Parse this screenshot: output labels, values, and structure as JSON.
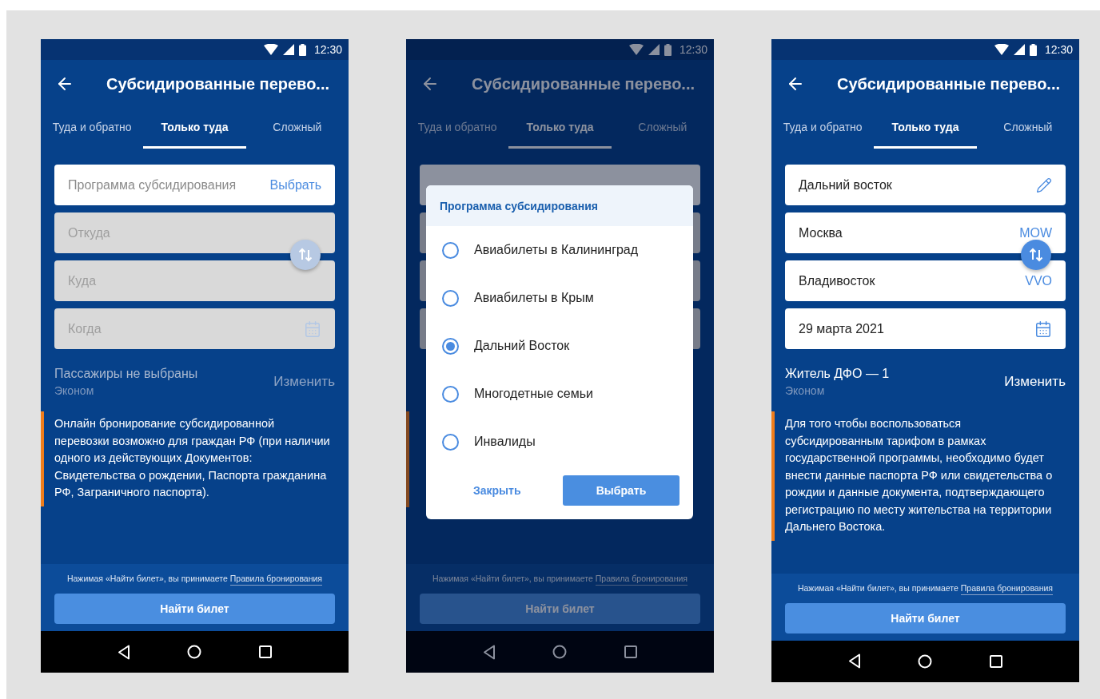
{
  "screens": [
    {
      "kind": "form",
      "time": "12:30",
      "title": "Субсидированные перево...",
      "tabs": [
        {
          "label": "Туда и обратно",
          "selected": false
        },
        {
          "label": "Только туда",
          "selected": true
        },
        {
          "label": "Сложный",
          "selected": false
        }
      ],
      "fields": [
        {
          "kind": "choice",
          "placeholder": "Программа субсидирования",
          "action": "Выбрать",
          "disabled": false
        },
        {
          "kind": "city",
          "placeholder": "Откуда",
          "disabled": true
        },
        {
          "kind": "city",
          "placeholder": "Куда",
          "disabled": true
        },
        {
          "kind": "date",
          "placeholder": "Когда",
          "disabled": true
        }
      ],
      "swap": {
        "disabled": true
      },
      "passengers": {
        "title": "Пассажиры не выбраны",
        "class": "Эконом",
        "action": "Изменить",
        "disabled": true
      },
      "info": "Онлайн бронирование субсидированной перевозки возможно для граждан РФ (при наличии одного из действующих Документов: Свидетельства о рождении, Паспорта гражданина РФ, Заграничного паспорта).",
      "footer": {
        "notice": "Нажимая «Найти билет», вы принимаете",
        "link": "Правила бронирования",
        "button": "Найти билет"
      }
    },
    {
      "kind": "dialog",
      "time": "12:30",
      "title": "Субсидированные перево...",
      "tabs": [
        {
          "label": "Туда и обратно",
          "selected": false
        },
        {
          "label": "Только туда",
          "selected": true
        },
        {
          "label": "Сложный",
          "selected": false
        }
      ],
      "dialog": {
        "title": "Программа субсидирования",
        "options": [
          {
            "label": "Авиабилеты в Калининград",
            "selected": false
          },
          {
            "label": "Авиабилеты в Крым",
            "selected": false
          },
          {
            "label": "Дальний Восток",
            "selected": true
          },
          {
            "label": "Многодетные семьи",
            "selected": false
          },
          {
            "label": "Инвалиды",
            "selected": false
          }
        ],
        "close": "Закрыть",
        "select": "Выбрать"
      },
      "footer": {
        "notice": "Нажимая «Найти билет», вы принимаете",
        "link": "Правила бронирования",
        "button": "Найти билет"
      }
    },
    {
      "kind": "form",
      "time": "12:30",
      "title": "Субсидированные перево...",
      "tabs": [
        {
          "label": "Туда и обратно",
          "selected": false
        },
        {
          "label": "Только туда",
          "selected": true
        },
        {
          "label": "Сложный",
          "selected": false
        }
      ],
      "fields": [
        {
          "kind": "edit",
          "value": "Дальний восток",
          "disabled": false
        },
        {
          "kind": "city",
          "value": "Москва",
          "code": "MOW",
          "disabled": false
        },
        {
          "kind": "city",
          "value": "Владивосток",
          "code": "VVO",
          "disabled": false
        },
        {
          "kind": "date",
          "value": "29 марта 2021",
          "disabled": false
        }
      ],
      "swap": {
        "disabled": false
      },
      "passengers": {
        "title": "Житель ДФО — 1",
        "class": "Эконом",
        "action": "Изменить",
        "disabled": false
      },
      "info": "Для того чтобы воспользоваться субсидированным тарифом в рамках государственной программы, необходимо будет внести данные паспорта РФ или свидетельства о рождии и данные документа, подтверждающего регистрацию по месту жительства на территории Дальнего Востока.",
      "footer": {
        "notice": "Нажимая «Найти билет», вы принимаете",
        "link": "Правила бронирования",
        "button": "Найти билет"
      }
    }
  ]
}
